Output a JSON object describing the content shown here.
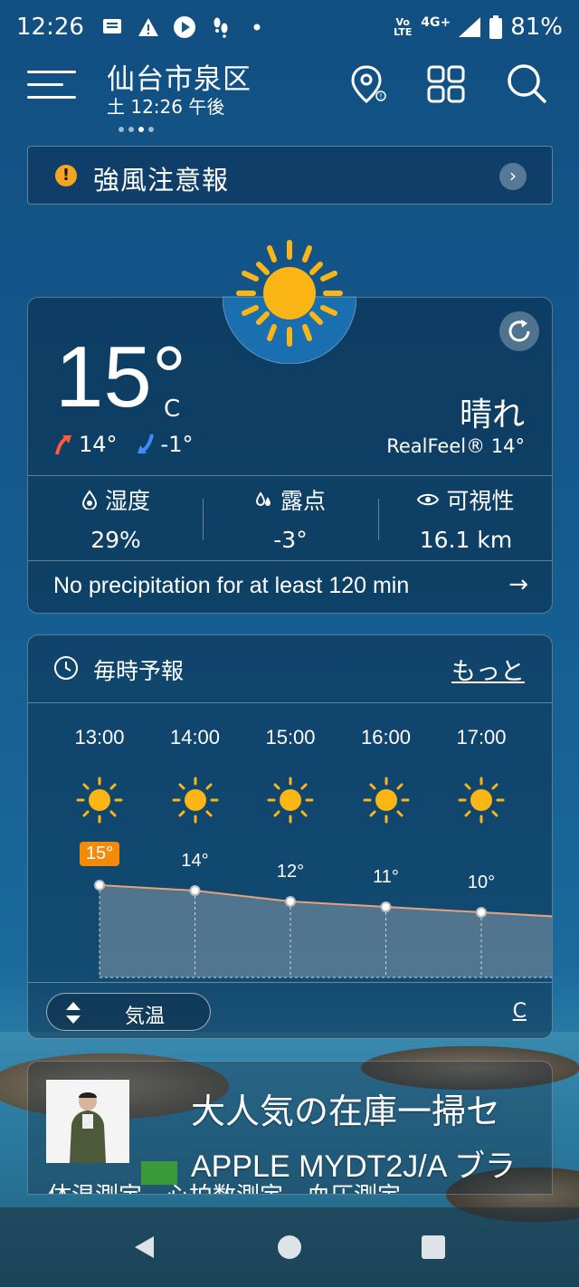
{
  "status_bar": {
    "time": "12:26",
    "network_volte": "Vo LTE",
    "network_type": "4G+",
    "battery": "81%"
  },
  "header": {
    "location": "仙台市泉区",
    "datetime": "土 12:26 午後",
    "icons": [
      "menu-icon",
      "location-pin-icon",
      "grid-icon",
      "search-icon"
    ]
  },
  "alert": {
    "text": "強風注意報",
    "icon": "warning-icon",
    "color": "#f5a623"
  },
  "current": {
    "temp": "15°",
    "unit": "C",
    "high": "14°",
    "low": "-1°",
    "condition": "晴れ",
    "realfeel": "RealFeel® 14°",
    "stats": [
      {
        "label": "湿度",
        "value": "29%",
        "icon": "humidity-icon"
      },
      {
        "label": "露点",
        "value": "-3°",
        "icon": "dewpoint-icon"
      },
      {
        "label": "可視性",
        "value": "16.1 km",
        "icon": "eye-icon"
      }
    ],
    "precip_text": "No precipitation for at least 120 min"
  },
  "hourly": {
    "title": "毎時予報",
    "more": "もっと",
    "toggle_label": "気温",
    "unit": "C",
    "accent": "#f58a0a",
    "hours": [
      {
        "time": "13:00",
        "temp": "15°"
      },
      {
        "time": "14:00",
        "temp": "14°"
      },
      {
        "time": "15:00",
        "temp": "12°"
      },
      {
        "time": "16:00",
        "temp": "11°"
      },
      {
        "time": "17:00",
        "temp": "10°"
      }
    ]
  },
  "chart_data": {
    "type": "area",
    "categories": [
      "13:00",
      "14:00",
      "15:00",
      "16:00",
      "17:00"
    ],
    "values": [
      15,
      14,
      12,
      11,
      10
    ],
    "xlabel": "",
    "ylabel": ""
  },
  "ad": {
    "title": "大人気の在庫一掃セ",
    "subtitle": "APPLE MYDT2J/A ブラ",
    "line3": "体温測定　心拍数測定　血圧測定"
  }
}
